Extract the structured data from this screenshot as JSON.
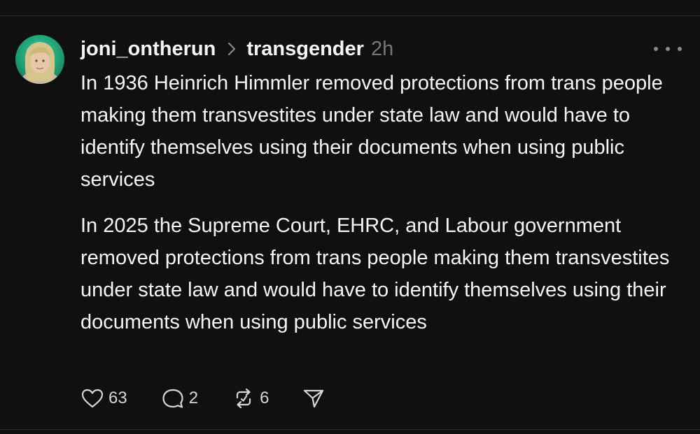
{
  "post": {
    "author": "joni_ontherun",
    "community": "transgender",
    "time": "2h",
    "paragraphs": [
      "In 1936 Heinrich Himmler removed protections from trans people making them transvestites under state law and would have to identify themselves using their documents when using public services",
      "In 2025 the Supreme Court, EHRC, and Labour government removed protections from trans people making them transvestites under state law and would have to identify themselves using their documents when using public services"
    ],
    "actions": {
      "likes": "63",
      "replies": "2",
      "reposts": "6"
    },
    "icons": {
      "more": "more-horizontal-icon",
      "like": "heart-icon",
      "reply": "speech-bubble-icon",
      "repost": "repost-icon",
      "share": "send-icon"
    }
  }
}
